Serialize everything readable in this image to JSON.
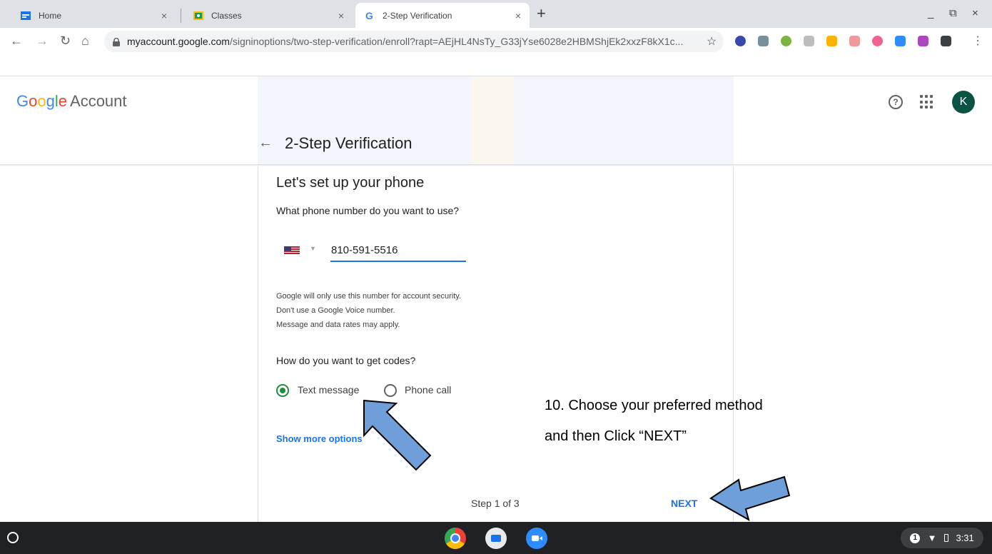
{
  "browser": {
    "tabs": [
      {
        "title": "Home",
        "icon": "classroom-home-icon"
      },
      {
        "title": "Classes",
        "icon": "google-classroom-icon"
      },
      {
        "title": "2-Step Verification",
        "icon": "google-g-icon"
      }
    ],
    "new_tab": "+",
    "window_controls": {
      "minimize": "_",
      "restore": "⧉",
      "close": "×"
    },
    "url_host": "myaccount.google.com",
    "url_path": "/signinoptions/two-step-verification/enroll?rapt=AEjHL4NsTy_G33jYse6028e2HBMShjEk2xxzF8kX1c...",
    "extension_icons": [
      "k-icon",
      "person-icon",
      "power-icon",
      "home-icon",
      "thumb-icon",
      "arrow-icon",
      "target-icon",
      "zoom-icon",
      "robot-icon",
      "puzzle-icon"
    ]
  },
  "page": {
    "logo_google": "Google",
    "logo_account": "Account",
    "avatar_letter": "K",
    "help_glyph": "?",
    "back_glyph": "←",
    "title": "2-Step Verification",
    "heading": "Let's set up your phone",
    "phone_question": "What phone number do you want to use?",
    "country": "United States",
    "phone_value": "810-591-5516",
    "notes": [
      "Google will only use this number for account security.",
      "Don't use a Google Voice number.",
      "Message and data rates may apply."
    ],
    "codes_question": "How do you want to get codes?",
    "options": [
      {
        "label": "Text message",
        "selected": true
      },
      {
        "label": "Phone call",
        "selected": false
      }
    ],
    "show_more": "Show more options",
    "step": "Step 1 of 3",
    "next": "NEXT"
  },
  "annotation": {
    "line1": "10. Choose your preferred method",
    "line2": "and then Click “NEXT”"
  },
  "shelf": {
    "apps": [
      "chrome-icon",
      "camera-icon",
      "zoom-icon"
    ],
    "notification_count": "1",
    "time": "3:31"
  },
  "colors": {
    "link_blue": "#1a73e8",
    "radio_green": "#1e8e3e",
    "avatar_green": "#0b5345",
    "arrow_fill": "#6f9fd8"
  }
}
